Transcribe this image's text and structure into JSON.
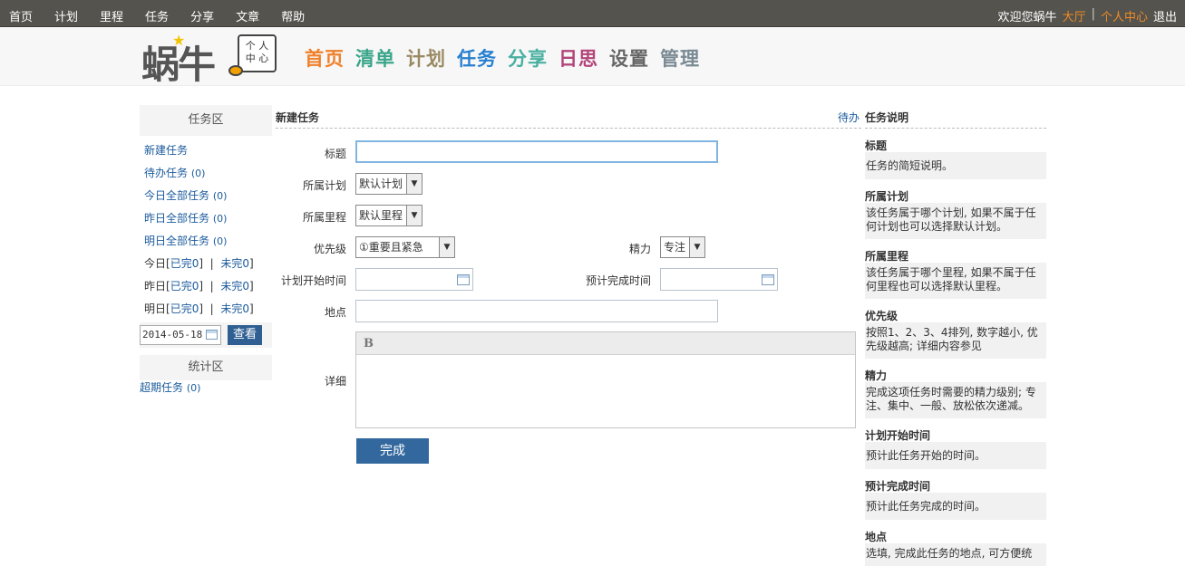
{
  "topbar": {
    "nav": [
      "首页",
      "计划",
      "里程",
      "任务",
      "分享",
      "文章",
      "帮助"
    ],
    "welcome": "欢迎您蜗牛",
    "hall": "大厅",
    "separator": "|",
    "personal": "个人中心",
    "logout": "退出"
  },
  "header": {
    "logo_text": "蜗牛",
    "stamp_line1": "个 人",
    "stamp_line2": "中 心",
    "nav": [
      {
        "label": "首页",
        "color": "#f0802a"
      },
      {
        "label": "清单",
        "color": "#3aa58a"
      },
      {
        "label": "计划",
        "color": "#9a8a63"
      },
      {
        "label": "任务",
        "color": "#2880d0"
      },
      {
        "label": "分享",
        "color": "#48b0a0"
      },
      {
        "label": "日思",
        "color": "#b3457a"
      },
      {
        "label": "设置",
        "color": "#666666"
      },
      {
        "label": "管理",
        "color": "#7a8a93"
      }
    ]
  },
  "sidebar": {
    "task_area_title": "任务区",
    "links": [
      {
        "label": "新建任务",
        "count": ""
      },
      {
        "label": "待办任务",
        "count": "(0)"
      },
      {
        "label": "今日全部任务",
        "count": "(0)"
      },
      {
        "label": "昨日全部任务",
        "count": "(0)"
      },
      {
        "label": "明日全部任务",
        "count": "(0)"
      }
    ],
    "days": [
      {
        "day": "今日",
        "done": "已完0",
        "undone": "未完0"
      },
      {
        "day": "昨日",
        "done": "已完0",
        "undone": "未完0"
      },
      {
        "day": "明日",
        "done": "已完0",
        "undone": "未完0"
      }
    ],
    "date_value": "2014-05-18",
    "look_button": "查看",
    "stat_area_title": "统计区",
    "overdue": {
      "label": "超期任务",
      "count": "(0)"
    }
  },
  "form": {
    "title": "新建任务",
    "todo_link": "待办",
    "labels": {
      "title": "标题",
      "plan": "所属计划",
      "milestone": "所属里程",
      "priority": "优先级",
      "energy": "精力",
      "start_time": "计划开始时间",
      "finish_time": "预计完成时间",
      "location": "地点",
      "detail": "详细"
    },
    "values": {
      "title": "",
      "plan": "默认计划",
      "milestone": "默认里程",
      "priority": "①重要且紧急",
      "energy": "专注",
      "start_time": "",
      "finish_time": "",
      "location": ""
    },
    "editor_bold": "B",
    "submit": "完成"
  },
  "help": {
    "title": "任务说明",
    "sections": [
      {
        "name": "标题",
        "desc": "任务的简短说明。"
      },
      {
        "name": "所属计划",
        "desc": "该任务属于哪个计划, 如果不属于任何计划也可以选择默认计划。"
      },
      {
        "name": "所属里程",
        "desc": "该任务属于哪个里程, 如果不属于任何里程也可以选择默认里程。"
      },
      {
        "name": "优先级",
        "desc": "按照1、2、3、4排列, 数字越小, 优先级越高; 详细内容参见"
      },
      {
        "name": "精力",
        "desc": "完成这项任务时需要的精力级别; 专注、集中、一般、放松依次递减。"
      },
      {
        "name": "计划开始时间",
        "desc": "预计此任务开始的时间。"
      },
      {
        "name": "预计完成时间",
        "desc": "预计此任务完成的时间。"
      },
      {
        "name": "地点",
        "desc": "选填, 完成此任务的地点, 可方便统"
      }
    ]
  }
}
